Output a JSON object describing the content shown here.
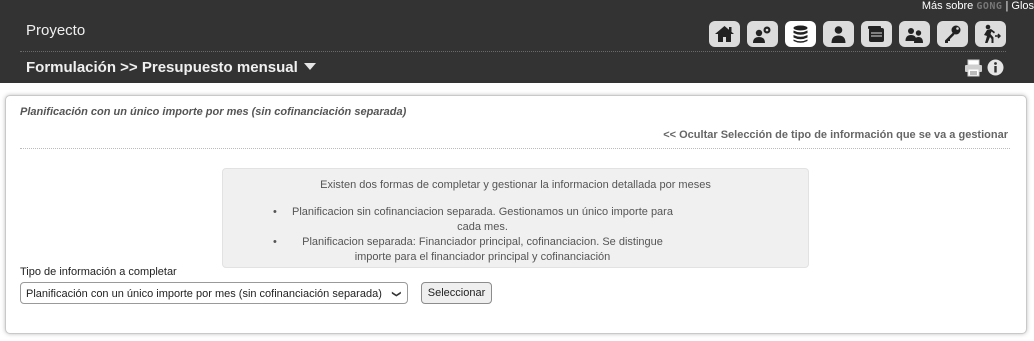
{
  "header": {
    "mas_sobre_prefix": "Más sobre",
    "mas_sobre_brand": "GONG",
    "mas_sobre_suffix": "| Glos",
    "project_title": "Proyecto",
    "breadcrumb": "Formulación >> Presupuesto mensual"
  },
  "toolbar_icons": [
    "home-icon",
    "users-gear-icon",
    "database-icon",
    "user-icon",
    "wallet-icon",
    "group-icon",
    "key-icon",
    "exit-icon"
  ],
  "active_icon": "database-icon",
  "utility_icons": [
    "print-icon",
    "info-icon"
  ],
  "panel": {
    "title": "Planificación con un único importe por mes (sin cofinanciación separada)",
    "toggle_link": "<< Ocultar Selección de tipo de información que se va a gestionar",
    "info_intro": "Existen dos formas de completar y gestionar la informacion detallada por meses",
    "info_items": [
      "Planificacion sin cofinanciacion separada. Gestionamos un único importe para cada mes.",
      "Planificacion separada: Financiador principal, cofinanciacion. Se distingue importe para el financiador principal y cofinanciación"
    ],
    "field_label": "Tipo de información a completar",
    "select_value": "Planificación con un único importe por mes (sin cofinanciación separada)",
    "button_label": "Seleccionar"
  },
  "colors": {
    "topbar": "#333333",
    "icon_bg": "#dcdcdc",
    "icon_active": "#ffffff",
    "info_box": "#f0f0f0"
  }
}
